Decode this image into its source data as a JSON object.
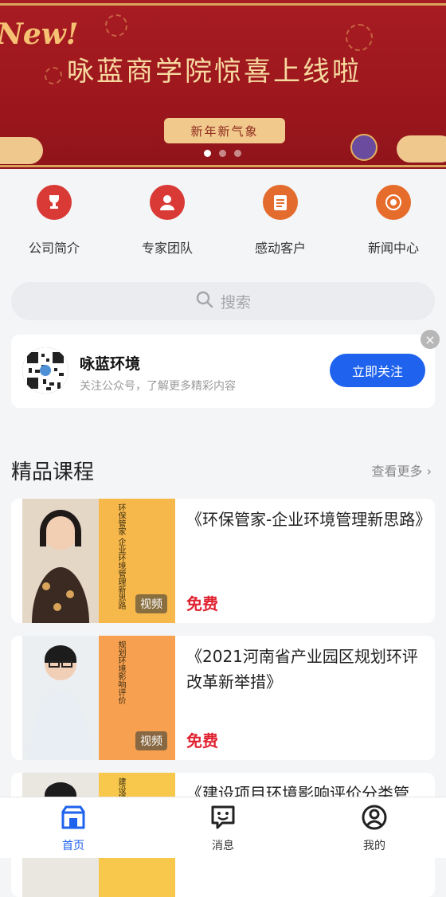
{
  "banner": {
    "new_text": "New!",
    "headline": "咏蓝商学院惊喜上线啦",
    "tag": "新年新气象",
    "slides": 3,
    "active_slide": 1
  },
  "quick_links": [
    {
      "label": "公司简介",
      "icon": "trophy-icon",
      "color": "#d93a35"
    },
    {
      "label": "专家团队",
      "icon": "expert-icon",
      "color": "#d93a35"
    },
    {
      "label": "感动客户",
      "icon": "clipboard-icon",
      "color": "#e36b2d"
    },
    {
      "label": "新闻中心",
      "icon": "news-icon",
      "color": "#e66c2c"
    }
  ],
  "search": {
    "placeholder": "搜索"
  },
  "follow_card": {
    "name": "咏蓝环境",
    "desc": "关注公众号，了解更多精彩内容",
    "button": "立即关注"
  },
  "section": {
    "title": "精品课程",
    "more": "查看更多"
  },
  "courses": [
    {
      "title": "《环保管家-企业环境管理新思路》",
      "price": "免费",
      "badge": "视频",
      "thumb_text": "环保管家 企业环境管理新思路",
      "panel_color": "#f7b84b"
    },
    {
      "title": "《2021河南省产业园区规划环评改革新举措》",
      "price": "免费",
      "badge": "视频",
      "thumb_text": "规划环境影响评价",
      "panel_color": "#f6a050"
    },
    {
      "title": "《建设项目环境影响评价分类管",
      "price": "",
      "badge": "",
      "thumb_text": "建设项目",
      "panel_color": "#f7c84b"
    }
  ],
  "tabbar": [
    {
      "label": "首页",
      "icon": "home-icon",
      "active": true
    },
    {
      "label": "消息",
      "icon": "message-icon",
      "active": false
    },
    {
      "label": "我的",
      "icon": "user-icon",
      "active": false
    }
  ],
  "colors": {
    "accent": "#1e62ee",
    "price": "#e02331",
    "banner": "#a71c22"
  }
}
